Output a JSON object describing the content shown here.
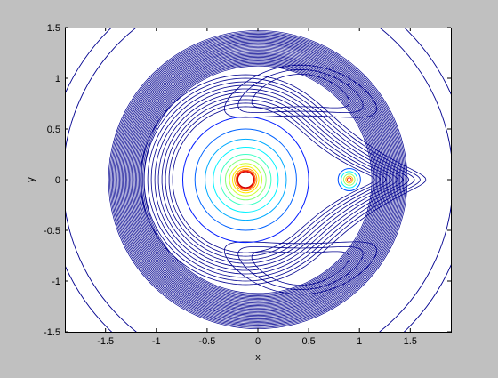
{
  "chart_data": {
    "type": "contour",
    "title": "",
    "xlabel": "x",
    "ylabel": "y",
    "xlim": [
      -1.9,
      1.9
    ],
    "ylim": [
      -1.5,
      1.5
    ],
    "xticks": [
      -1.5,
      -1,
      -0.5,
      0,
      0.5,
      1,
      1.5
    ],
    "xtick_labels": [
      "-1.5",
      "-1",
      "-0.5",
      "0",
      "0.5",
      "1",
      "1.5"
    ],
    "yticks": [
      -1.5,
      -1,
      -0.5,
      0,
      0.5,
      1,
      1.5
    ],
    "ytick_labels": [
      "-1.5",
      "-1",
      "-0.5",
      "0",
      "0.5",
      "1",
      "1.5"
    ],
    "grid": false,
    "colormap": "jet",
    "sources": [
      {
        "x": -0.12,
        "y": 0.0
      },
      {
        "x": 0.9,
        "y": 0.0
      }
    ],
    "colors": {
      "figure_bg": "#c0c0c0",
      "axes_bg": "#ffffff",
      "line_dark": "#00008f"
    }
  }
}
